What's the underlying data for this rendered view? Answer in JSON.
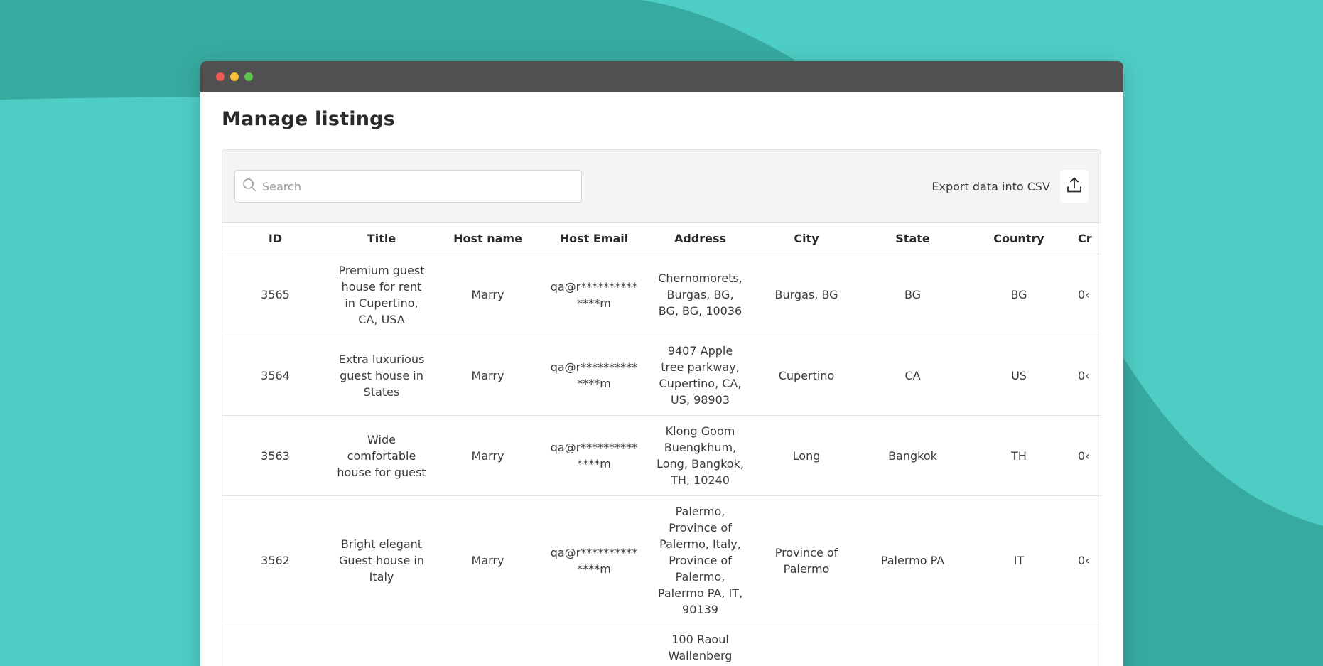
{
  "page": {
    "title": "Manage listings"
  },
  "search": {
    "placeholder": "Search"
  },
  "export": {
    "label": "Export data into CSV",
    "icon": "upload-icon"
  },
  "table": {
    "headers": [
      "ID",
      "Title",
      "Host name",
      "Host Email",
      "Address",
      "City",
      "State",
      "Country",
      "Cr"
    ],
    "rows": [
      {
        "id": "3565",
        "title": "Premium guest house for rent in Cupertino, CA, USA",
        "host_name": "Marry",
        "host_email": "qa@r**********\n****m",
        "address": "Chernomorets, Burgas, BG, BG, BG, 10036",
        "city": "Burgas, BG",
        "state": "BG",
        "country": "BG",
        "created": "0‹"
      },
      {
        "id": "3564",
        "title": "Extra luxurious guest house in States",
        "host_name": "Marry",
        "host_email": "qa@r**********\n****m",
        "address": "9407 Apple tree parkway, Cupertino, CA, US, 98903",
        "city": "Cupertino",
        "state": "CA",
        "country": "US",
        "created": "0‹"
      },
      {
        "id": "3563",
        "title": "Wide comfortable house for guest",
        "host_name": "Marry",
        "host_email": "qa@r**********\n****m",
        "address": "Klong Goom Buengkhum, Long, Bangkok, TH, 10240",
        "city": "Long",
        "state": "Bangkok",
        "country": "TH",
        "created": "0‹"
      },
      {
        "id": "3562",
        "title": "Bright elegant Guest house in Italy",
        "host_name": "Marry",
        "host_email": "qa@r**********\n****m",
        "address": "Palermo, Province of Palermo, Italy, Province of Palermo, Palermo PA, IT, 90139",
        "city": "Province of Palermo",
        "state": "Palermo PA",
        "country": "IT",
        "created": "0‹"
      },
      {
        "id": "",
        "title": "",
        "host_name": "",
        "host_email": "",
        "address": "100 Raoul Wallenberg",
        "city": "",
        "state": "",
        "country": "",
        "created": ""
      }
    ]
  },
  "colors": {
    "background": "#4ecdc4",
    "background_wave": "#37aaa0",
    "titlebar": "#505050",
    "dot_red": "#ed5a53",
    "dot_yellow": "#f5be3b",
    "dot_green": "#5fc24d"
  }
}
